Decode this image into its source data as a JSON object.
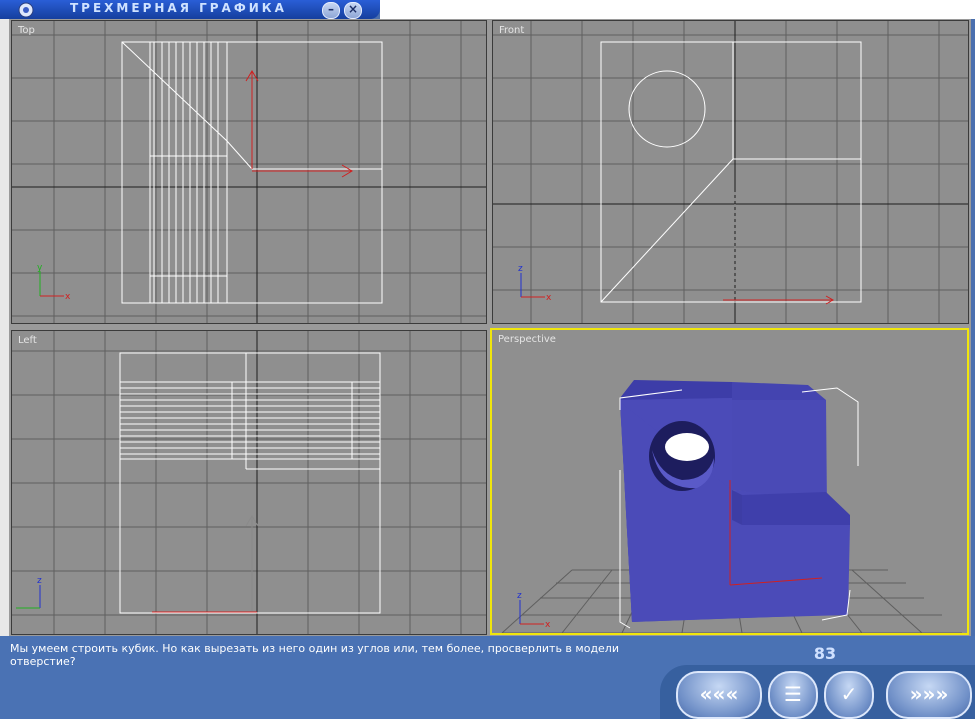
{
  "window": {
    "title": "ТРЕХМЕРНАЯ ГРАФИКА",
    "minimize_label": "–",
    "close_label": "×"
  },
  "viewports": {
    "top": {
      "label": "Top"
    },
    "front": {
      "label": "Front"
    },
    "left": {
      "label": "Left"
    },
    "perspective": {
      "label": "Perspective"
    }
  },
  "axis_labels": {
    "x": "x",
    "y": "y",
    "z": "z"
  },
  "footer": {
    "message": "Мы умеем строить кубик. Но как вырезать из него один из углов или, тем более, просверлить в модели отверстие?",
    "page_number": "83"
  },
  "nav": {
    "prev_label": "«««",
    "menu_label": "☰",
    "check_label": "✓",
    "next_label": "»»»"
  },
  "colors": {
    "viewport_bg": "#8f8f8f",
    "grid": "#5f5f5f",
    "wire": "#ffffff",
    "active_border": "#f0e60c",
    "model": "#4b4bb8",
    "x_axis": "#d02020",
    "y_axis": "#20b020",
    "z_axis": "#2030d0"
  }
}
